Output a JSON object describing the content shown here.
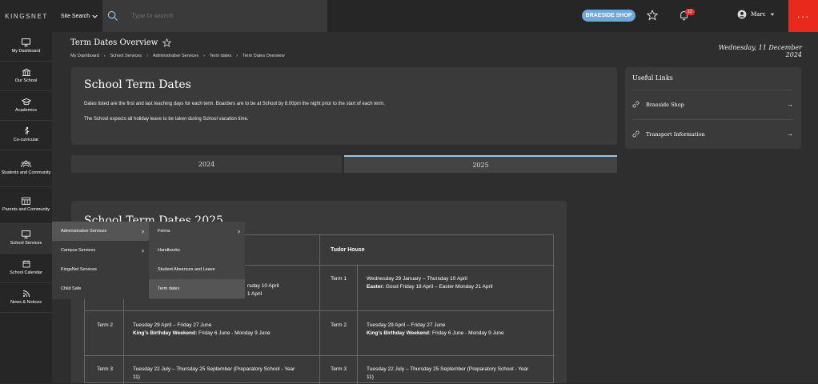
{
  "brand": {
    "logo": "KINGSNET",
    "colors": {
      "accent": "#e8291c",
      "shop": "#6fa8dc"
    }
  },
  "topbar": {
    "site_search": "Site Search",
    "search_placeholder": "Type to search",
    "shop_button": "BRAESIDE SHOP",
    "notifications": "12",
    "user_name": "Marc",
    "menu_icon": "more-dots-icon"
  },
  "sidebar": {
    "items": [
      {
        "label": "My Dashboard",
        "icon": "monitor-icon"
      },
      {
        "label": "Our School",
        "icon": "building-icon"
      },
      {
        "label": "Academics",
        "icon": "graduation-cap-icon"
      },
      {
        "label": "Co-curricular",
        "icon": "running-icon"
      },
      {
        "label": "Students and Community",
        "icon": "users-icon"
      },
      {
        "label": "Parents and Community",
        "icon": "calendar-grid-icon"
      },
      {
        "label": "School Services",
        "icon": "monitor-icon"
      },
      {
        "label": "School Calendar",
        "icon": "calendar-icon"
      },
      {
        "label": "News & Notices",
        "icon": "rss-icon"
      }
    ]
  },
  "page": {
    "title": "Term Dates Overview",
    "date": "Wednesday, 11 December 2024",
    "breadcrumbs": [
      "My Dashboard",
      "School Services",
      "Administrative Services",
      "Term dates",
      "Term Dates Overview"
    ]
  },
  "intro": {
    "heading": "School Term Dates",
    "para1": "Dates listed are the first and last teaching days for each term. Boarders are to be at School by 8.00pm the night prior to the start of each term.",
    "para2": "The School expects all holiday leave to be taken during School vacation time."
  },
  "useful_links": {
    "heading": "Useful Links",
    "items": [
      "Braeside Shop",
      "Transport Information"
    ]
  },
  "tabs": [
    "2024",
    "2025"
  ],
  "dates": {
    "heading": "School Term Dates 2025",
    "col2_header": "Tudor House",
    "rows": [
      {
        "term_left": "",
        "left_line1": "rsday 10 April",
        "left_line2": "1 April",
        "term_right": "Term 1",
        "right_line1": "Wednesday 29 January – Thursday 10 April",
        "right_bold": "Easter:",
        "right_line2": " Good Friday 18 April – Easter Monday 21 April"
      },
      {
        "term_left": "Term 2",
        "left_line1": "Tuesday 29 April – Friday 27 June",
        "left_bold": "King's Birthday Weekend:",
        "left_line2": " Friday 6 June - Monday 9 June",
        "term_right": "Term 2",
        "right_line1": "Tuesday 29 April – Friday 27 June",
        "right_bold": "King's Birthday Weekend:",
        "right_line2": " Friday 6 June - Monday 9 June"
      },
      {
        "term_left": "Term 3",
        "left_line1": "Tuesday 22 July – Thursday 25 September (Preparatory School - Year",
        "left_line2": "11)",
        "term_right": "Term 3",
        "right_line1": "Tuesday 22 July – Thursday 25 September (Preparatory School - Year",
        "right_line2": "11)"
      }
    ]
  },
  "dropdown": {
    "col1": [
      "Administrative Services",
      "Campus Services",
      "KingsNet Services",
      "Child Safe"
    ],
    "col2": [
      "Forms",
      "Handbooks",
      "Student Absences and Leave",
      "Term dates"
    ]
  }
}
